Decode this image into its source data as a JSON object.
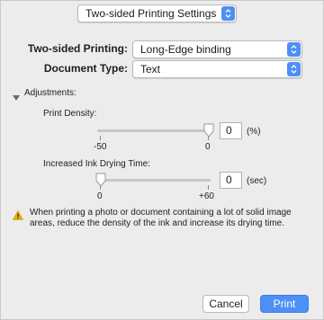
{
  "header": {
    "settings_select_value": "Two-sided Printing Settings"
  },
  "two_sided": {
    "label": "Two-sided Printing:",
    "value": "Long-Edge binding"
  },
  "document_type": {
    "label": "Document Type:",
    "value": "Text"
  },
  "adjustments": {
    "label": "Adjustments:",
    "print_density": {
      "label": "Print Density:",
      "value": "0",
      "unit": "(%)",
      "min_label": "-50",
      "max_label": "0",
      "min": -50,
      "max": 0,
      "level": 0
    },
    "drying_time": {
      "label": "Increased Ink Drying Time:",
      "value": "0",
      "unit": "(sec)",
      "min_label": "0",
      "max_label": "+60",
      "min": 0,
      "max": 60,
      "level": 0
    }
  },
  "warning": {
    "line1": "When printing a photo or document containing a lot of solid image",
    "line2": "areas, reduce the density of the ink and increase its drying time."
  },
  "buttons": {
    "cancel": "Cancel",
    "print": "Print"
  },
  "colors": {
    "accent": "#4c90f6",
    "warning": "#e5b400"
  },
  "icons": [
    "up-down-chevron-icon",
    "disclosure-triangle-icon",
    "warning-icon",
    "slider-thumb-icon"
  ]
}
